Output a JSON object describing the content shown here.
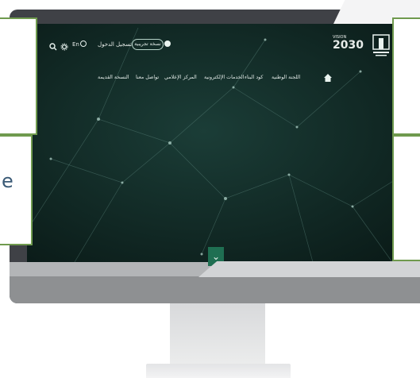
{
  "header": {
    "demo_version_label": "نسخة تجريبية",
    "login_label": "تسجيل الدخول",
    "language_label": "En",
    "vision_label": "VISION",
    "vision_year": "2030"
  },
  "nav": {
    "items": [
      {
        "label": "اللجنة الوطنية"
      },
      {
        "label": "كود البناء"
      },
      {
        "label": "الخدمات الإلكترونية"
      },
      {
        "label": "المركز الإعلامي"
      },
      {
        "label": "تواصل معنا"
      },
      {
        "label": "النسخة القديمة"
      }
    ]
  },
  "side_text": {
    "left_peek": "e"
  },
  "colors": {
    "screen_bg": "#0f2622",
    "accent_green": "#1f6f52",
    "overlay_border": "#6f9a4e"
  },
  "icons": {
    "search": "search-icon",
    "settings": "gear-icon",
    "globe": "globe-icon",
    "user": "user-icon",
    "home": "home-icon",
    "scroll": "chevron-double-down-icon"
  }
}
